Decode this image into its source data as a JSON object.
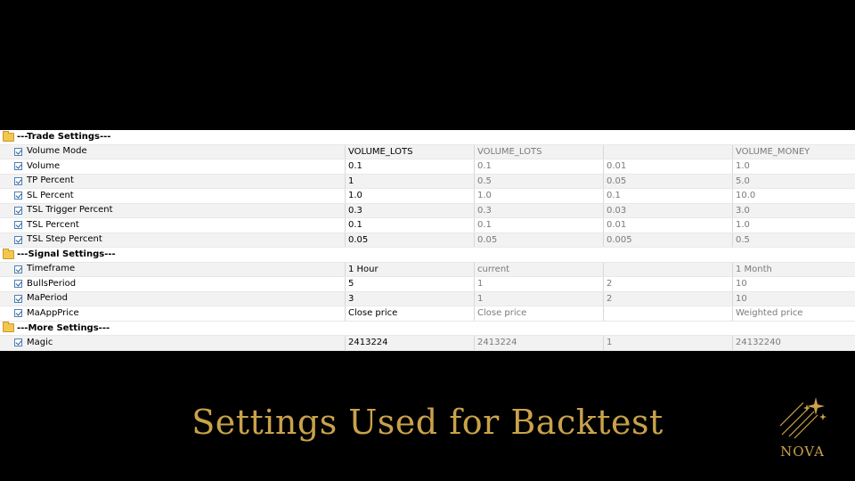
{
  "groups": [
    {
      "label": "---Trade Settings---",
      "rows": [
        {
          "name": "Volume Mode",
          "value": "VOLUME_LOTS",
          "start": "VOLUME_LOTS",
          "step": "",
          "stop": "VOLUME_MONEY"
        },
        {
          "name": "Volume",
          "value": "0.1",
          "start": "0.1",
          "step": "0.01",
          "stop": "1.0"
        },
        {
          "name": "TP Percent",
          "value": "1",
          "start": "0.5",
          "step": "0.05",
          "stop": "5.0"
        },
        {
          "name": "SL Percent",
          "value": "1.0",
          "start": "1.0",
          "step": "0.1",
          "stop": "10.0"
        },
        {
          "name": "TSL Trigger Percent",
          "value": "0.3",
          "start": "0.3",
          "step": "0.03",
          "stop": "3.0"
        },
        {
          "name": "TSL Percent",
          "value": "0.1",
          "start": "0.1",
          "step": "0.01",
          "stop": "1.0"
        },
        {
          "name": "TSL Step Percent",
          "value": "0.05",
          "start": "0.05",
          "step": "0.005",
          "stop": "0.5"
        }
      ]
    },
    {
      "label": "---Signal Settings---",
      "rows": [
        {
          "name": "Timeframe",
          "value": "1 Hour",
          "start": "current",
          "step": "",
          "stop": "1 Month"
        },
        {
          "name": "BullsPeriod",
          "value": "5",
          "start": "1",
          "step": "2",
          "stop": "10"
        },
        {
          "name": "MaPeriod",
          "value": "3",
          "start": "1",
          "step": "2",
          "stop": "10"
        },
        {
          "name": "MaAppPrice",
          "value": "Close price",
          "start": "Close price",
          "step": "",
          "stop": "Weighted price"
        }
      ]
    },
    {
      "label": "---More Settings---",
      "rows": [
        {
          "name": "Magic",
          "value": "2413224",
          "start": "2413224",
          "step": "1",
          "stop": "24132240"
        }
      ]
    }
  ],
  "title": "Settings Used for Backtest",
  "logo": {
    "text": "NOVA"
  },
  "colors": {
    "accent_gold": "#c9a24a",
    "background": "#000000"
  }
}
